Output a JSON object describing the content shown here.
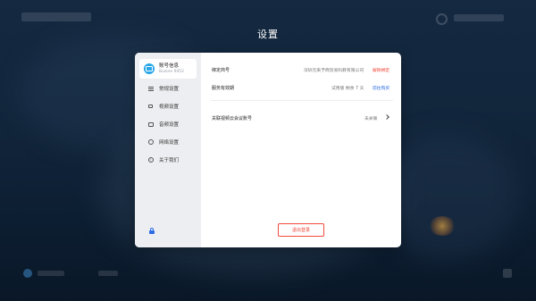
{
  "page": {
    "title": "设置"
  },
  "sidebar": {
    "account": {
      "name": "账号信息",
      "id": "Busine 9452"
    },
    "items": [
      {
        "label": "常规设置",
        "icon": "sliders-icon"
      },
      {
        "label": "视频设置",
        "icon": "camera-icon"
      },
      {
        "label": "音频设置",
        "icon": "speaker-icon"
      },
      {
        "label": "网络设置",
        "icon": "globe-icon"
      },
      {
        "label": "关于我们",
        "icon": "info-icon"
      }
    ]
  },
  "content": {
    "bound_account": {
      "label": "绑定商号",
      "value": "深圳元来予商贸易科教有限公司",
      "action": "解除绑定"
    },
    "service": {
      "label": "服务有效期",
      "value": "试用版  剩余 7 天",
      "action": "前往购买"
    },
    "linked_meeting": {
      "label": "关联视频云会议账号",
      "value": "未关联"
    },
    "logout_label": "退出登录"
  },
  "colors": {
    "accent_blue": "#2d6ee8",
    "danger_red": "#f24a3c",
    "sidebar_bg": "#edeef1"
  }
}
